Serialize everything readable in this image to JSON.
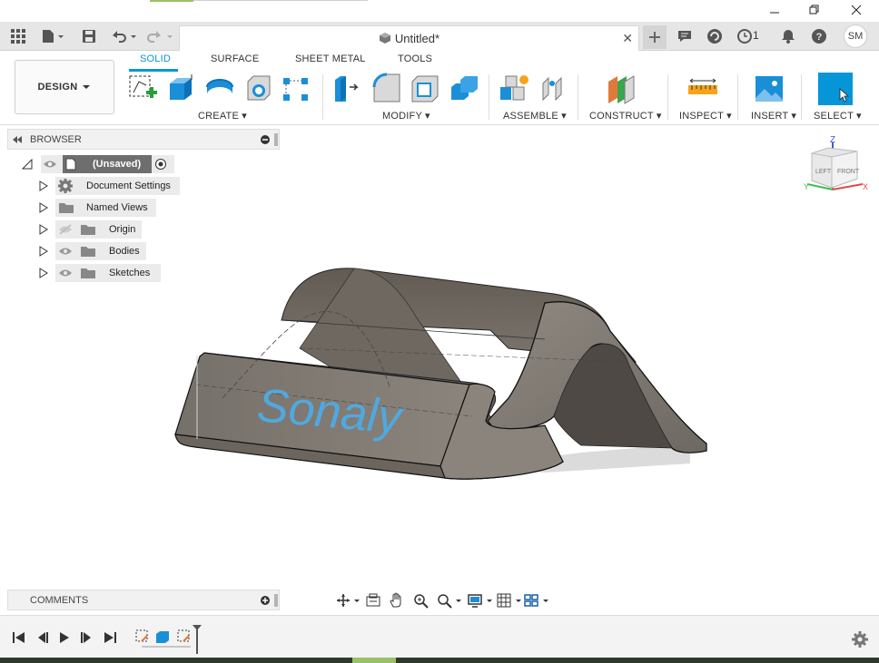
{
  "window": {
    "title": "Untitled*"
  },
  "appbar": {
    "job_count": "1",
    "user_initials": "SM"
  },
  "workspace": {
    "label": "DESIGN"
  },
  "tabs": [
    {
      "label": "SOLID",
      "active": true
    },
    {
      "label": "SURFACE",
      "active": false
    },
    {
      "label": "SHEET METAL",
      "active": false
    },
    {
      "label": "TOOLS",
      "active": false
    }
  ],
  "groups": {
    "create": "CREATE",
    "modify": "MODIFY",
    "assemble": "ASSEMBLE",
    "construct": "CONSTRUCT",
    "inspect": "INSPECT",
    "insert": "INSERT",
    "select": "SELECT"
  },
  "browser": {
    "title": "BROWSER",
    "root": "(Unsaved)",
    "items": [
      {
        "label": "Document Settings",
        "icon": "gear-icon"
      },
      {
        "label": "Named Views",
        "icon": "folder-icon"
      },
      {
        "label": "Origin",
        "icon": "folder-icon"
      },
      {
        "label": "Bodies",
        "icon": "folder-icon"
      },
      {
        "label": "Sketches",
        "icon": "folder-icon"
      }
    ]
  },
  "comments": {
    "title": "COMMENTS"
  },
  "viewcube": {
    "top": "Z",
    "left_face": "LEFT",
    "front_face": "FRONT",
    "x": "X",
    "y": "Y"
  },
  "model": {
    "engraved_text": "Sonaly"
  },
  "colors": {
    "accent": "#0696d7",
    "model_body": "#77716a",
    "text_emboss": "#4fa9e0"
  }
}
